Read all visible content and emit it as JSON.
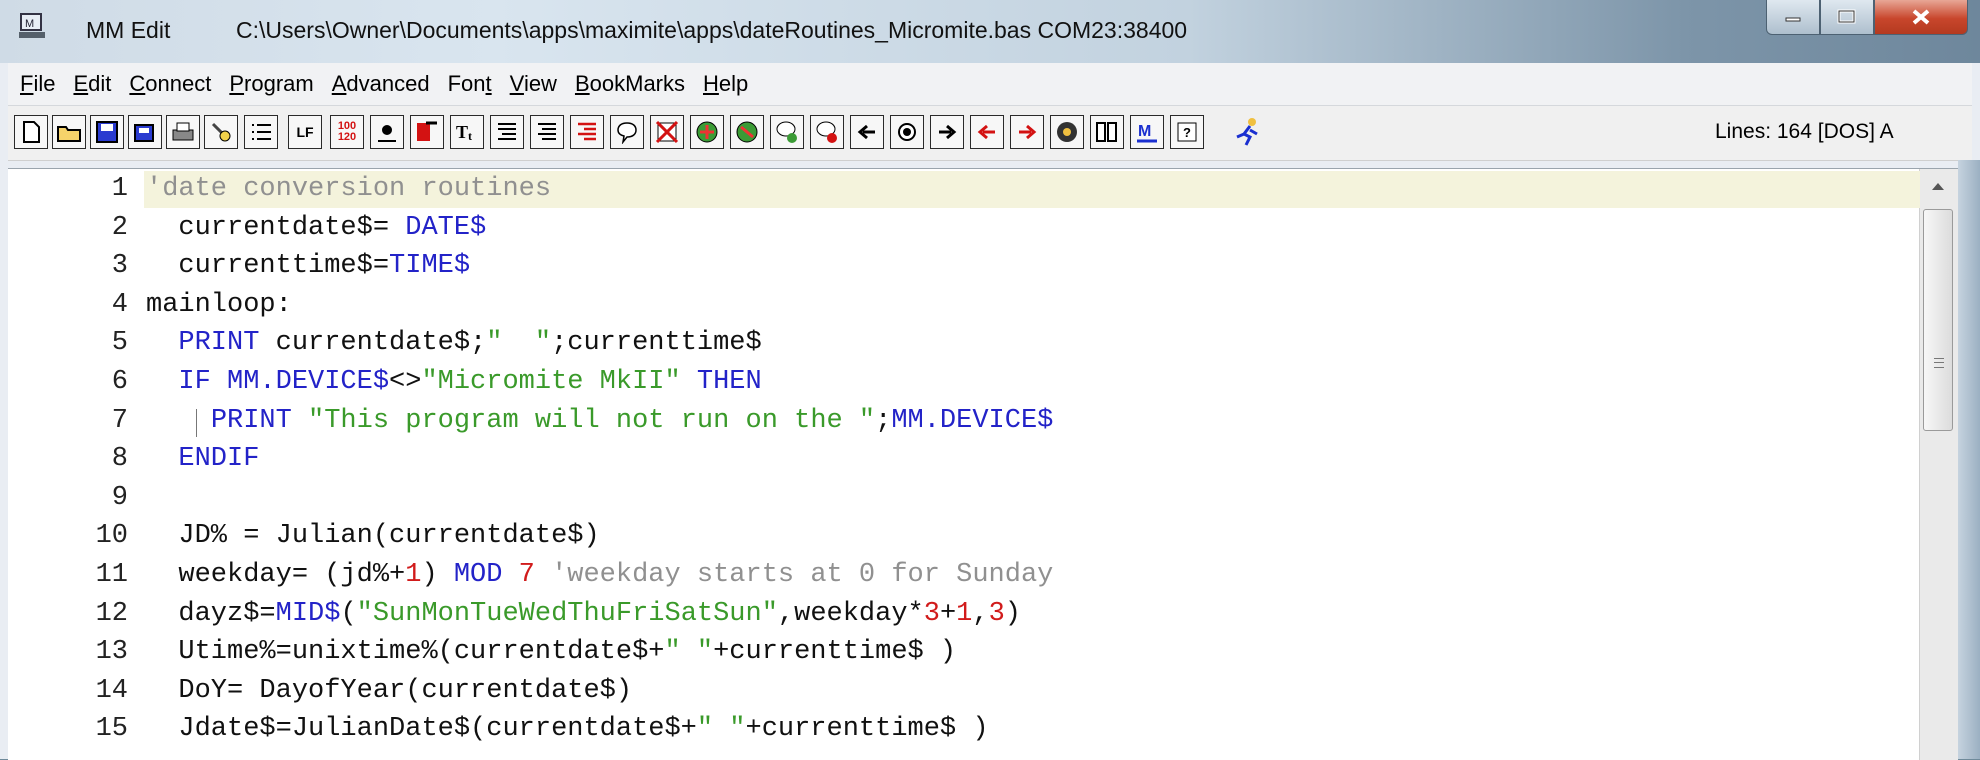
{
  "titlebar": {
    "app_name": "MM Edit",
    "path": "C:\\Users\\Owner\\Documents\\apps\\maximite\\apps\\dateRoutines_Micromite.bas   COM23:38400"
  },
  "menu": [
    {
      "label": "File",
      "accel": "F",
      "rest": "ile"
    },
    {
      "label": "Edit",
      "accel": "E",
      "rest": "dit"
    },
    {
      "label": "Connect",
      "accel": "C",
      "rest": "onnect"
    },
    {
      "label": "Program",
      "accel": "P",
      "rest": "rogram"
    },
    {
      "label": "Advanced",
      "accel": "A",
      "rest": "dvanced"
    },
    {
      "label": "Font",
      "accel": "F",
      "rest": "ont",
      "underline_last": true
    },
    {
      "label": "View",
      "accel": "V",
      "rest": "iew"
    },
    {
      "label": "BookMarks",
      "accel": "B",
      "rest": "ookMarks"
    },
    {
      "label": "Help",
      "accel": "H",
      "rest": "elp"
    }
  ],
  "toolbar": {
    "buttons": [
      "new-file",
      "open-file",
      "save",
      "save-all",
      "print",
      "find",
      "list",
      "line-feed",
      "line-numbers",
      "bullet",
      "format-red",
      "font-size",
      "align-left",
      "align-right",
      "align-red",
      "comment",
      "delete",
      "run-green",
      "stop-green",
      "bubble-add",
      "bubble-remove",
      "arrow-left",
      "record",
      "arrow-right",
      "arrow-left-red",
      "arrow-right-red",
      "gear",
      "columns",
      "memory",
      "help",
      "runner"
    ],
    "line_feed_label": "LF",
    "num_label_top": "100",
    "num_label_bottom": "120",
    "status": "Lines: 164 [DOS]  A"
  },
  "editor": {
    "lines": [
      {
        "n": "1",
        "html": "<span class='c'>'date conversion routines</span>"
      },
      {
        "n": "2",
        "html": "  currentdate$= <span class='k'>DATE$</span>"
      },
      {
        "n": "3",
        "html": "  currenttime$=<span class='k'>TIME$</span>"
      },
      {
        "n": "4",
        "html": "mainloop:"
      },
      {
        "n": "5",
        "html": "  <span class='k'>PRINT</span> currentdate$;<span class='s'>\"  \"</span>;currenttime$"
      },
      {
        "n": "6",
        "html": "  <span class='k'>IF MM.DEVICE$</span>&lt;&gt;<span class='s'>\"Micromite MkII\"</span> <span class='k'>THEN</span>"
      },
      {
        "n": "7",
        "html": "    <span class='k'>PRINT</span> <span class='s'>\"This program will not run on the \"</span>;<span class='k'>MM.DEVICE$</span>"
      },
      {
        "n": "8",
        "html": "  <span class='k'>ENDIF</span>"
      },
      {
        "n": "9",
        "html": ""
      },
      {
        "n": "10",
        "html": "  JD% = Julian(currentdate$)"
      },
      {
        "n": "11",
        "html": "  weekday= (jd%+<span class='n'>1</span>) <span class='k'>MOD</span> <span class='n'>7</span> <span class='c'>'weekday starts at 0 for Sunday</span>"
      },
      {
        "n": "12",
        "html": "  dayz$=<span class='k'>MID$</span>(<span class='s'>\"SunMonTueWedThuFriSatSun\"</span>,weekday*<span class='n'>3</span>+<span class='n'>1</span>,<span class='n'>3</span>)"
      },
      {
        "n": "13",
        "html": "  Utime%=unixtime%(currentdate$+<span class='s'>\" \"</span>+currenttime$ )"
      },
      {
        "n": "14",
        "html": "  DoY= DayofYear(currentdate$)"
      },
      {
        "n": "15",
        "html": "  Jdate$=JulianDate$(currentdate$+<span class='s'>\" \"</span>+currenttime$ )"
      }
    ],
    "colors": {
      "keyword": "#2323c8",
      "string": "#3a9a2a",
      "number": "#d11b1b",
      "comment": "#909090",
      "current_line": "#f4f3dc"
    }
  }
}
